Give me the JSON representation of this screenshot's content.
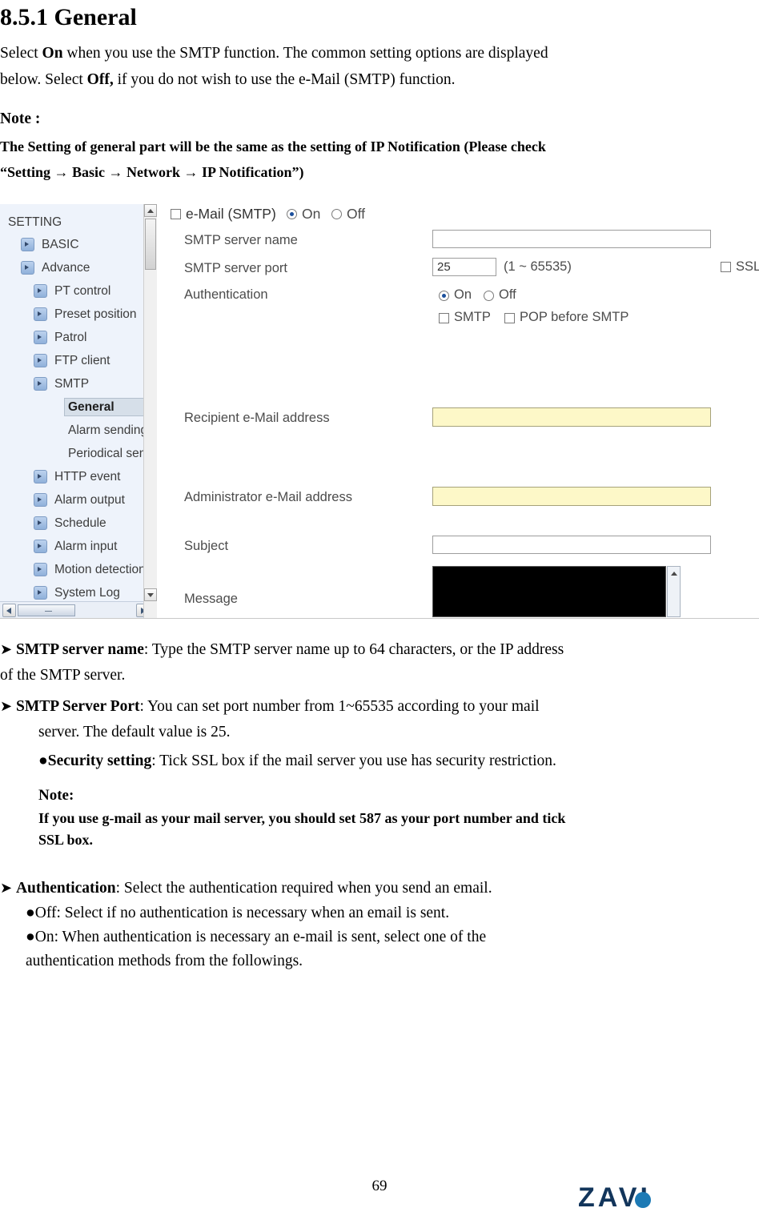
{
  "heading": "8.5.1 General",
  "intro": {
    "line1_a": "Select ",
    "line1_b": "On",
    "line1_c": " when you use the SMTP function. The common setting options are displayed",
    "line2_a": "below. Select ",
    "line2_b": "Off,",
    "line2_c": " if you do not wish to use the e-Mail (SMTP) function."
  },
  "note1": {
    "label": "Note :",
    "line1": "The Setting of general part will be the same as the setting of IP Notification (Please check",
    "line2": "“Setting → Basic → Network → IP Notification”)"
  },
  "figure": {
    "sidebar": {
      "items": [
        {
          "label": "SETTING",
          "level": 0,
          "arrow": false
        },
        {
          "label": "BASIC",
          "level": 1,
          "arrow": true
        },
        {
          "label": "Advance",
          "level": 1,
          "arrow": true
        },
        {
          "label": "PT control",
          "level": 2,
          "arrow": true
        },
        {
          "label": "Preset position",
          "level": 2,
          "arrow": true
        },
        {
          "label": "Patrol",
          "level": 2,
          "arrow": true
        },
        {
          "label": "FTP client",
          "level": 2,
          "arrow": true
        },
        {
          "label": "SMTP",
          "level": 2,
          "arrow": true
        },
        {
          "label": "General",
          "level": 3,
          "arrow": false,
          "selected": true
        },
        {
          "label": "Alarm sending",
          "level": 3,
          "arrow": false
        },
        {
          "label": "Periodical sen",
          "level": 3,
          "arrow": false
        },
        {
          "label": "HTTP event",
          "level": 2,
          "arrow": true
        },
        {
          "label": "Alarm output",
          "level": 2,
          "arrow": true
        },
        {
          "label": "Schedule",
          "level": 2,
          "arrow": true
        },
        {
          "label": "Alarm input",
          "level": 2,
          "arrow": true
        },
        {
          "label": "Motion detection",
          "level": 2,
          "arrow": true
        },
        {
          "label": "System Log",
          "level": 2,
          "arrow": true
        }
      ]
    },
    "form": {
      "title": "e-Mail (SMTP)",
      "title_on": "On",
      "title_off": "Off",
      "server_name_label": "SMTP server name",
      "server_port_label": "SMTP server port",
      "server_port_value": "25",
      "server_port_range": "(1 ~ 65535)",
      "ssl_label": "SSL",
      "authentication_label": "Authentication",
      "auth_on": "On",
      "auth_off": "Off",
      "auth_smtp": "SMTP",
      "auth_pop_before_smtp": "POP before SMTP",
      "recipient_label": "Recipient e-Mail address",
      "administrator_label": "Administrator e-Mail address",
      "subject_label": "Subject",
      "message_label": "Message"
    }
  },
  "bullets": {
    "b1_a": "SMTP server name",
    "b1_b": ": Type the SMTP server name up to 64 characters, or the IP address",
    "b1_c": "of the SMTP server.",
    "b2_a": "SMTP Server Port",
    "b2_b": ": You can set port number from 1~65535 according to your mail",
    "b2_c": "server. The default value is 25.",
    "b3_a": "Security setting",
    "b3_b": ": Tick SSL box if the mail server you use has security restriction.",
    "note2_label": "Note:",
    "note2_line1": "If you use g-mail as your mail server, you should set 587 as your port number and tick",
    "note2_line2": "SSL box.",
    "b4_a": "Authentication",
    "b4_b": ": Select the authentication required when you send an email.",
    "b4_c": "Off: Select if no authentication is necessary when an email is sent.",
    "b4_d": "On: When authentication is necessary an e-mail is sent, select one of the",
    "b4_e": "authentication methods from the followings."
  },
  "footer": {
    "page_number": "69",
    "logo_text": "ZAVI"
  }
}
